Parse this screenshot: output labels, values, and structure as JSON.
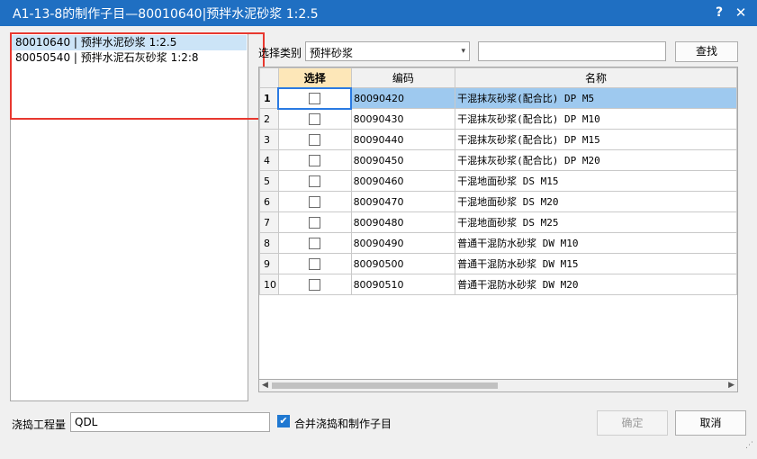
{
  "window": {
    "title": "A1-13-8的制作子目—80010640|预拌水泥砂浆 1:2.5",
    "help_glyph": "?",
    "close_glyph": "✕"
  },
  "left_list": {
    "items": [
      {
        "label": "80010640 | 预拌水泥砂浆 1:2.5"
      },
      {
        "label": "80050540 | 预拌水泥石灰砂浆 1:2:8"
      }
    ]
  },
  "filter": {
    "category_label": "选择类别",
    "category_value": "预拌砂浆",
    "search_value": "",
    "search_button": "查找"
  },
  "table": {
    "columns": [
      "",
      "选择",
      "编码",
      "名称"
    ],
    "rows": [
      {
        "index": "1",
        "code": "80090420",
        "name": "干混抹灰砂浆(配合比) DP M5"
      },
      {
        "index": "2",
        "code": "80090430",
        "name": "干混抹灰砂浆(配合比) DP M10"
      },
      {
        "index": "3",
        "code": "80090440",
        "name": "干混抹灰砂浆(配合比) DP M15"
      },
      {
        "index": "4",
        "code": "80090450",
        "name": "干混抹灰砂浆(配合比) DP M20"
      },
      {
        "index": "5",
        "code": "80090460",
        "name": "干混地面砂浆 DS M15"
      },
      {
        "index": "6",
        "code": "80090470",
        "name": "干混地面砂浆 DS M20"
      },
      {
        "index": "7",
        "code": "80090480",
        "name": "干混地面砂浆 DS M25"
      },
      {
        "index": "8",
        "code": "80090490",
        "name": "普通干混防水砂浆 DW M10"
      },
      {
        "index": "9",
        "code": "80090500",
        "name": "普通干混防水砂浆 DW M15"
      },
      {
        "index": "10",
        "code": "80090510",
        "name": "普通干混防水砂浆 DW M20"
      }
    ]
  },
  "footer": {
    "quantity_label": "浇捣工程量",
    "quantity_value": "QDL",
    "merge_label": "合并浇捣和制作子目",
    "ok_button": "确定",
    "cancel_button": "取消"
  },
  "colors": {
    "titlebar": "#1f6fc2",
    "highlight_box": "#e8382f",
    "selected_row": "#9ec9ef",
    "selection_header": "#fde7b8"
  }
}
